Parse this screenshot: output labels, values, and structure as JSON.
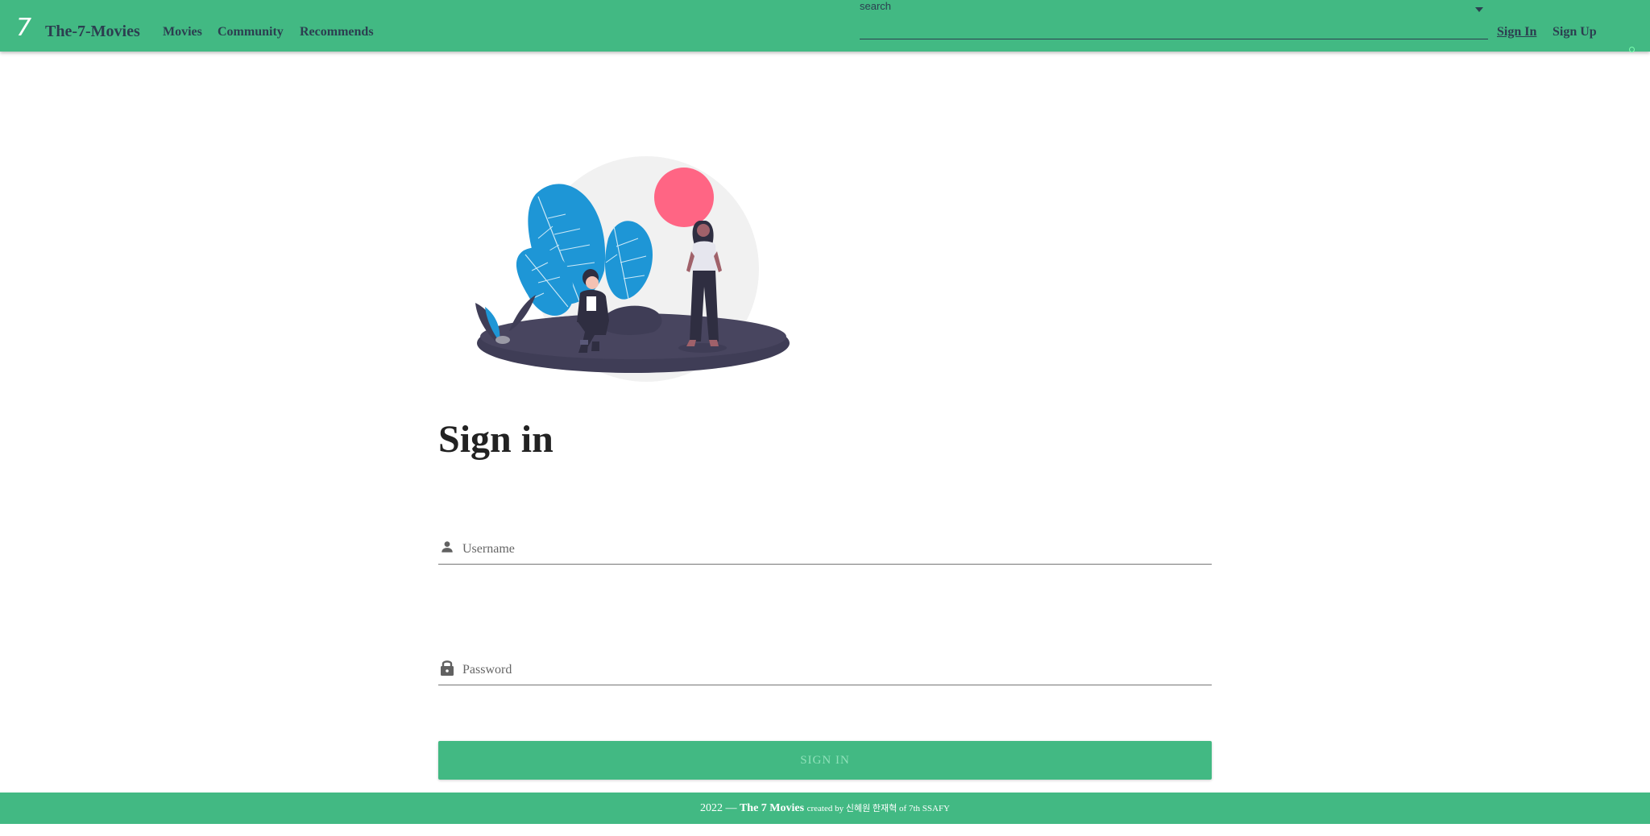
{
  "header": {
    "logo_text": "7",
    "brand": "The-7-Movies",
    "nav": [
      "Movies",
      "Community",
      "Recommends"
    ],
    "search_label": "search",
    "search_value": "",
    "sign_in": "Sign In",
    "sign_up": "Sign Up"
  },
  "main": {
    "title": "Sign in",
    "username_placeholder": "Username",
    "password_placeholder": "Password",
    "submit_label": "SIGN IN"
  },
  "footer": {
    "year": "2022 —",
    "site": "The 7 Movies",
    "credit": "created by 신혜원 한재혁 of 7th SSAFY"
  },
  "colors": {
    "brand_green": "#42b983",
    "text_dark": "#2c3e50",
    "leaf_blue": "#1e96d6",
    "sun_pink": "#ff6584",
    "ground": "#3f3d56"
  },
  "icons": {
    "username": "person-icon",
    "password": "lock-icon",
    "search_dropdown": "chevron-down-icon"
  }
}
